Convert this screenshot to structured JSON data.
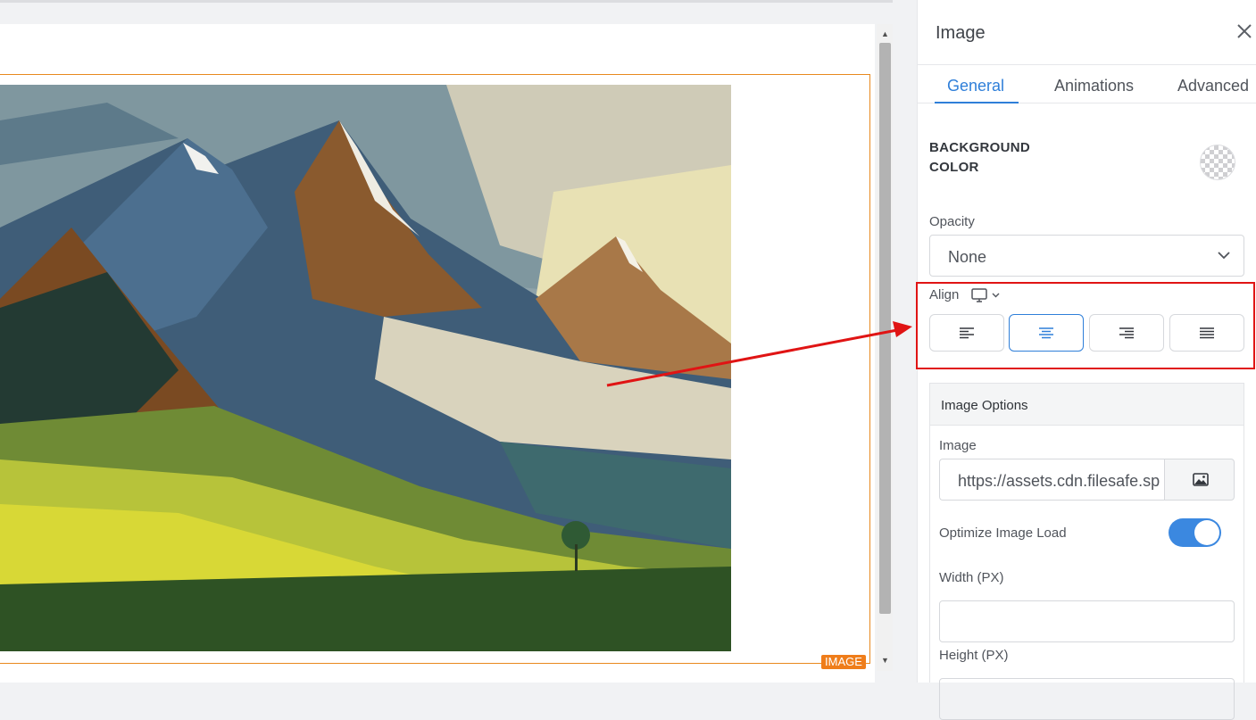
{
  "canvas": {
    "element_tag": "IMAGE",
    "image_alt": "Illustrated mountain landscape"
  },
  "panel": {
    "title": "Image",
    "close_icon": "close-icon",
    "tabs": [
      {
        "label": "General",
        "active": true
      },
      {
        "label": "Animations",
        "active": false
      },
      {
        "label": "Advanced",
        "active": false
      }
    ],
    "background_color_label_1": "BACKGROUND",
    "background_color_label_2": "COLOR",
    "opacity": {
      "label": "Opacity",
      "value": "None"
    },
    "align": {
      "label": "Align",
      "device_icon": "monitor-icon",
      "options": [
        "left",
        "center",
        "right",
        "justify"
      ],
      "selected": "center"
    },
    "image_options": {
      "heading": "Image Options",
      "image_label": "Image",
      "image_url": "https://assets.cdn.filesafe.sp",
      "optimize_label": "Optimize Image Load",
      "optimize_on": true,
      "width_label": "Width (PX)",
      "height_label": "Height (PX)"
    }
  },
  "colors": {
    "accent": "#2f7fd9",
    "annotation": "#e01414",
    "frame": "#e8891e"
  }
}
